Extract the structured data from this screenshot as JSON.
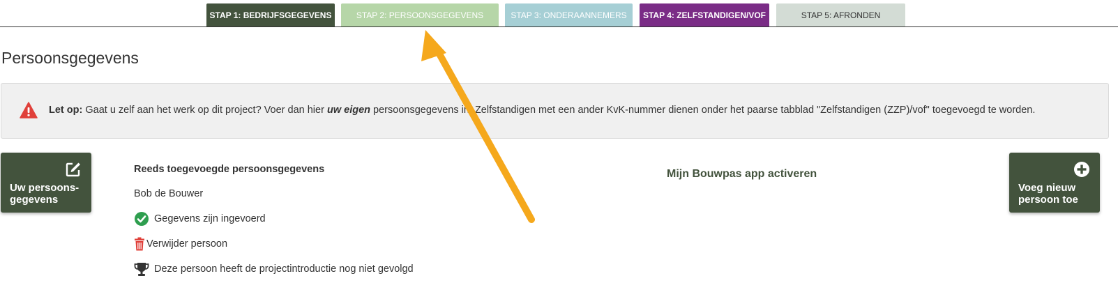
{
  "tabs": [
    {
      "label": "STAP 1: BEDRIJFSGEGEVENS",
      "color": "#43533d"
    },
    {
      "label": "STAP 2: PERSOONSGEGEVENS",
      "color": "#b6d6a8"
    },
    {
      "label": "STAP 3: ONDERAANNEMERS",
      "color": "#a6cfd5"
    },
    {
      "label": "STAP 4: ZELFSTANDIGEN/VOF",
      "color": "#7a2c86"
    },
    {
      "label": "STAP 5: AFRONDEN",
      "color": "#d3dcd5"
    }
  ],
  "page": {
    "title": "Persoonsgegevens"
  },
  "alert": {
    "label": "Let op:",
    "text_before": " Gaat u zelf aan het werk op dit project? Voer dan hier ",
    "emphasis": "uw eigen",
    "text_after": " persoonsgegevens in. Zelfstandigen met een ander KvK-nummer dienen onder het paarse tabblad \"Zelfstandigen (ZZP)/vof\" toegevoegd te worden.",
    "icon": "warning-triangle-icon"
  },
  "tiles": {
    "left": {
      "line1": "Uw persoons-",
      "line2": "gegevens",
      "icon": "edit-icon"
    },
    "right": {
      "line1": "Voeg nieuw",
      "line2": "persoon toe",
      "icon": "plus-circle-icon"
    }
  },
  "list": {
    "heading": "Reeds toegevoegde persoonsgegevens",
    "name": "Bob de Bouwer",
    "status": "Gegevens zijn ingevoerd",
    "delete": "Verwijder persoon",
    "introduction": "Deze persoon heeft de projectintroductie nog niet gevolgd"
  },
  "activate": {
    "label": "Mijn Bouwpas app activeren"
  },
  "colors": {
    "primary": "#43533d",
    "success": "#2e9e4f",
    "danger": "#e0403a",
    "arrow": "#f5a81c"
  }
}
